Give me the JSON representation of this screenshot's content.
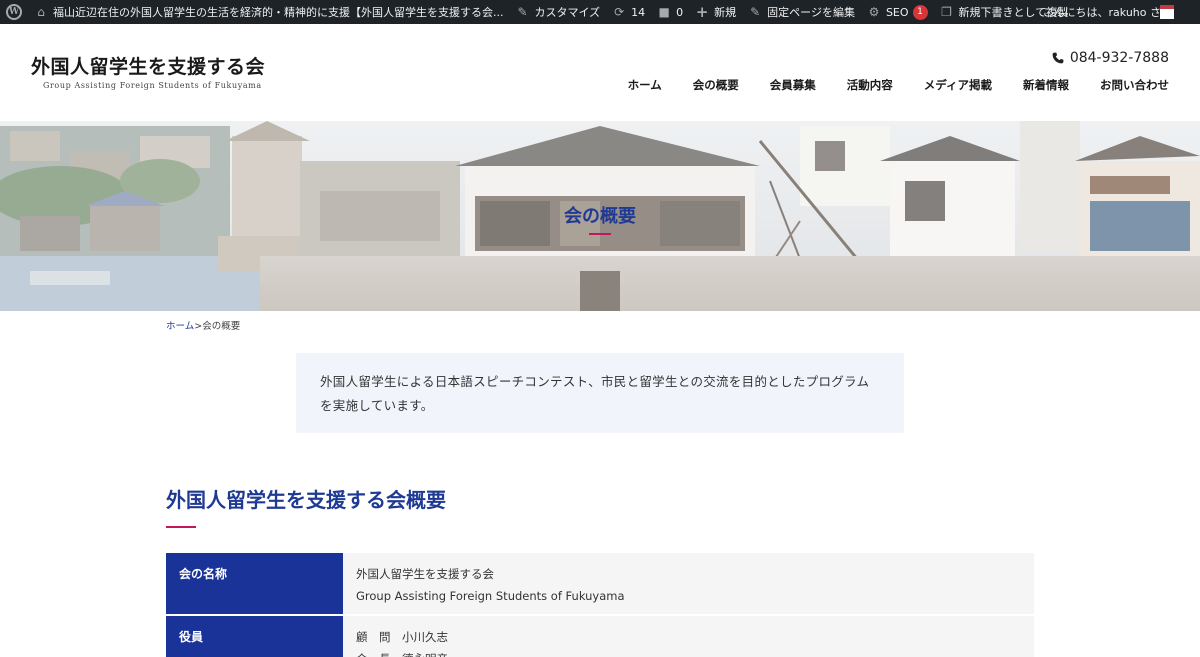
{
  "adminbar": {
    "site_name": "福山近辺在住の外国人留学生の生活を経済的・精神的に支援【外国人留学生を支援する会...",
    "customize": "カスタマイズ",
    "updates_count": "14",
    "comments_count": "0",
    "new_label": "新規",
    "edit_page": "固定ページを編集",
    "seo_label": "SEO",
    "seo_count": "1",
    "duplicate_draft": "新規下書きとして複製",
    "greeting": "こんにちは、rakuho さん"
  },
  "header": {
    "logo_title": "外国人留学生を支援する会",
    "logo_subtitle": "Group Assisting Foreign Students of Fukuyama",
    "phone": "084-932-7888",
    "nav": [
      "ホーム",
      "会の概要",
      "会員募集",
      "活動内容",
      "メディア掲載",
      "新着情報",
      "お問い合わせ"
    ]
  },
  "hero": {
    "title": "会の概要"
  },
  "breadcrumb": {
    "home": "ホーム",
    "separator": ">",
    "current": "会の概要"
  },
  "intro": {
    "text": "外国人留学生による日本語スピーチコンテスト、市民と留学生との交流を目的としたプログラムを実施しています。"
  },
  "section": {
    "title": "外国人留学生を支援する会概要"
  },
  "table": {
    "rows": [
      {
        "label": "会の名称",
        "lines": [
          "外国人留学生を支援する会",
          "Group Assisting Foreign Students of Fukuyama"
        ]
      },
      {
        "label": "役員",
        "lines": [
          "顧　問　小川久志",
          "会　長　德永明彦"
        ]
      }
    ]
  },
  "colors": {
    "brand_blue": "#1f3a93",
    "accent": "#c2185b",
    "table_header": "#1a3399",
    "intro_bg": "#f1f5fb",
    "adminbar": "#1d2327"
  }
}
